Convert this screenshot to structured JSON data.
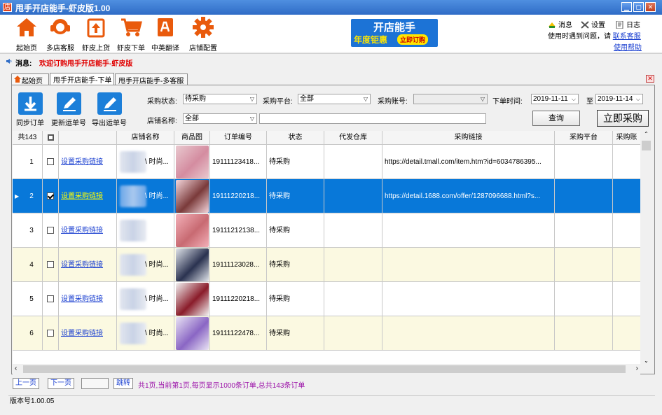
{
  "window": {
    "title": "甩手开店能手-虾皮版1.00",
    "app_icon": "shop-logo-icon"
  },
  "toolbar": [
    {
      "label": "起始页",
      "icon": "home-icon",
      "color": "#e95a0c"
    },
    {
      "label": "多店客服",
      "icon": "headset-icon",
      "color": "#e95a0c"
    },
    {
      "label": "虾皮上货",
      "icon": "upload-icon",
      "color": "#e95a0c"
    },
    {
      "label": "虾皮下单",
      "icon": "cart-icon",
      "color": "#e95a0c"
    },
    {
      "label": "中英翻译",
      "icon": "translate-icon",
      "color": "#e95a0c"
    },
    {
      "label": "店铺配置",
      "icon": "gear-icon",
      "color": "#e95a0c"
    }
  ],
  "banner": {
    "title": "开店能手",
    "promo": "年度钜惠",
    "cta": "立即订购"
  },
  "top_right": {
    "message": "消息",
    "settings": "设置",
    "log": "日志",
    "help_text": "使用时遇到问题，请",
    "contact": "联系客服",
    "help": "使用帮助"
  },
  "message_bar": {
    "label": "消息:",
    "text": "欢迎订购甩手开店能手-虾皮版"
  },
  "tabs": [
    {
      "label": "起始页",
      "active": false
    },
    {
      "label": "甩手开店能手-下单",
      "active": true
    },
    {
      "label": "甩手开店能手-多客服",
      "active": false
    }
  ],
  "actions": [
    {
      "label": "同步订单",
      "icon": "download-icon"
    },
    {
      "label": "更新运单号",
      "icon": "edit-icon"
    },
    {
      "label": "导出运单号",
      "icon": "edit-icon"
    }
  ],
  "filters": {
    "status_label": "采购状态:",
    "status_value": "待采购",
    "platform_label": "采购平台:",
    "platform_value": "全部",
    "account_label": "采购账号:",
    "account_value": "",
    "time_label": "下单时间:",
    "time_from": "2019-11-11",
    "time_to_label": "至",
    "time_to": "2019-11-14",
    "shop_label": "店铺名称:",
    "shop_value": "全部",
    "search_value": "",
    "query_button": "查询",
    "purchase_button": "立即采购"
  },
  "grid": {
    "count_label": "共143",
    "columns": [
      "店铺名称",
      "商品图",
      "订单编号",
      "状态",
      "代发仓库",
      "采购链接",
      "采购平台",
      "采购账"
    ],
    "rows": [
      {
        "no": "1",
        "checked": false,
        "link": "设置采购链接",
        "shop": "\\ 时尚...",
        "order": "19111123418...",
        "status": "待采购",
        "url": "https://detail.tmall.com/item.htm?id=6034786395...",
        "thumb": [
          "#e9c9cf",
          "#d48ca0"
        ]
      },
      {
        "no": "2",
        "checked": true,
        "link": "设置采购链接",
        "shop": "\\ 时尚...",
        "order": "19111220218...",
        "status": "待采购",
        "url": "https://detail.1688.com/offer/1287096688.html?s...",
        "thumb": [
          "#f4d6dc",
          "#7a3a3a"
        ]
      },
      {
        "no": "3",
        "checked": false,
        "link": "设置采购链接",
        "shop": "",
        "order": "19111212138...",
        "status": "待采购",
        "url": "",
        "thumb": [
          "#f3b0b8",
          "#c86a72"
        ]
      },
      {
        "no": "4",
        "checked": false,
        "link": "设置采购链接",
        "shop": "\\ 时尚...",
        "order": "19111123028...",
        "status": "待采购",
        "url": "",
        "thumb": [
          "#e0e4ea",
          "#2a3250"
        ]
      },
      {
        "no": "5",
        "checked": false,
        "link": "设置采购链接",
        "shop": "\\ 时尚...",
        "order": "19111220218...",
        "status": "待采购",
        "url": "",
        "thumb": [
          "#f2f2f2",
          "#8a1c2a"
        ]
      },
      {
        "no": "6",
        "checked": false,
        "link": "设置采购链接",
        "shop": "\\ 时尚...",
        "order": "19111122478...",
        "status": "待采购",
        "url": "",
        "thumb": [
          "#e9e3f4",
          "#8a66c4"
        ]
      }
    ]
  },
  "pager": {
    "prev": "上一页",
    "next": "下一页",
    "page_input": "",
    "jump": "跳转",
    "info": "共1页,当前第1页,每页显示1000条订单,总共143条订单"
  },
  "status_bar": {
    "version": "版本号1.00.05"
  }
}
